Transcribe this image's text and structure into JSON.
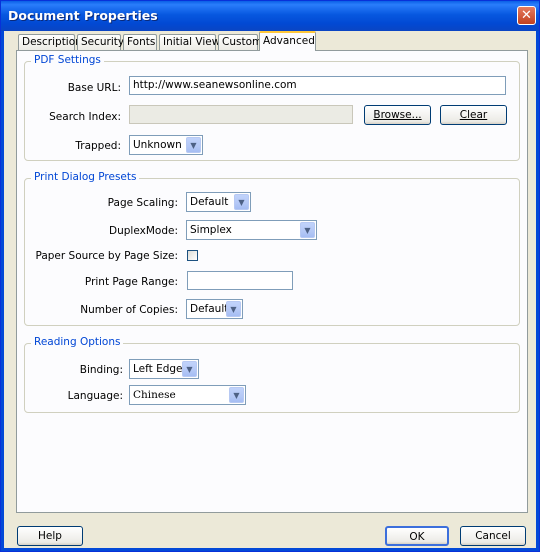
{
  "window": {
    "title": "Document Properties"
  },
  "tabs": [
    {
      "label": "Description"
    },
    {
      "label": "Security"
    },
    {
      "label": "Fonts"
    },
    {
      "label": "Initial View"
    },
    {
      "label": "Custom"
    },
    {
      "label": "Advanced"
    }
  ],
  "active_tab": "Advanced",
  "pdf_settings": {
    "legend": "PDF Settings",
    "base_url_label": "Base URL:",
    "base_url_value": "http://www.seanewsonline.com",
    "search_index_label": "Search Index:",
    "search_index_value": "",
    "browse_label": "Browse...",
    "clear_label": "Clear",
    "trapped_label": "Trapped:",
    "trapped_value": "Unknown"
  },
  "print_presets": {
    "legend": "Print Dialog Presets",
    "page_scaling_label": "Page Scaling:",
    "page_scaling_value": "Default",
    "duplex_label": "DuplexMode:",
    "duplex_value": "Simplex",
    "paper_source_label": "Paper Source by Page Size:",
    "paper_source_checked": false,
    "page_range_label": "Print Page Range:",
    "page_range_value": "",
    "copies_label": "Number of Copies:",
    "copies_value": "Default"
  },
  "reading_options": {
    "legend": "Reading Options",
    "binding_label": "Binding:",
    "binding_value": "Left Edge",
    "language_label": "Language:",
    "language_value": "Chinese"
  },
  "footer": {
    "help_label": "Help",
    "ok_label": "OK",
    "cancel_label": "Cancel"
  },
  "icons": {
    "close": "close-icon",
    "dropdown": "chevron-down-icon"
  },
  "colors": {
    "titlebar": "#0758e0",
    "group_legend": "#0046d5",
    "dialog_bg": "#ece9d8",
    "active_tab_accent": "#ffc83c"
  }
}
